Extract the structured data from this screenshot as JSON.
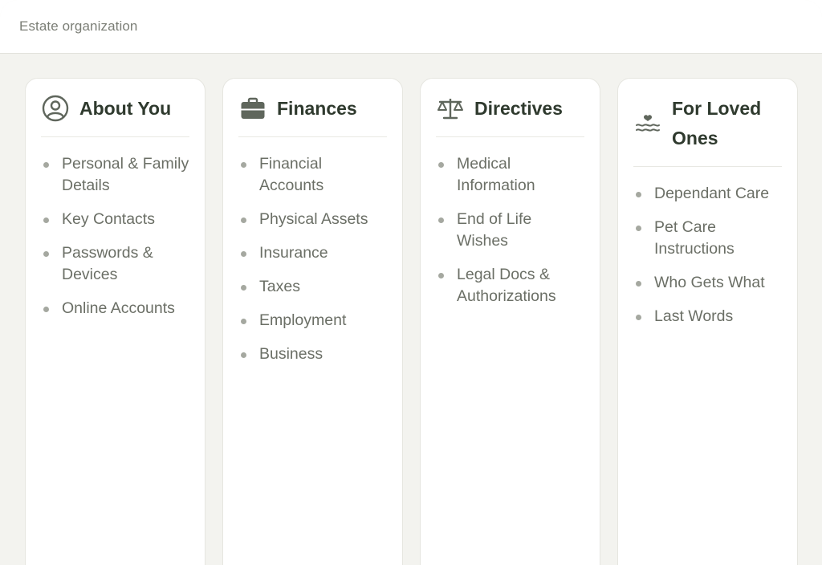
{
  "header": {
    "title": "Estate organization"
  },
  "colors": {
    "background": "#f3f3ef",
    "card": "#ffffff",
    "title_text": "#2f3a2e",
    "item_text": "#6b6f66",
    "bullet": "#a5a8a0",
    "icon": "#5f665c"
  },
  "cards": [
    {
      "title": "About You",
      "icon": "user-circle-icon",
      "items": [
        {
          "label": "Personal & Family Details"
        },
        {
          "label": "Key Contacts"
        },
        {
          "label": "Passwords & Devices"
        },
        {
          "label": "Online Accounts"
        }
      ]
    },
    {
      "title": "Finances",
      "icon": "briefcase-icon",
      "items": [
        {
          "label": "Financial Accounts"
        },
        {
          "label": "Physical Assets"
        },
        {
          "label": "Insurance"
        },
        {
          "label": "Taxes"
        },
        {
          "label": "Employment"
        },
        {
          "label": "Business"
        }
      ]
    },
    {
      "title": "Directives",
      "icon": "scales-icon",
      "items": [
        {
          "label": "Medical Information"
        },
        {
          "label": "End of Life Wishes"
        },
        {
          "label": "Legal Docs & Authorizations"
        }
      ]
    },
    {
      "title": "For Loved Ones",
      "icon": "heart-waves-icon",
      "items": [
        {
          "label": "Dependant Care"
        },
        {
          "label": "Pet Care Instructions"
        },
        {
          "label": "Who Gets What"
        },
        {
          "label": "Last Words"
        }
      ]
    }
  ]
}
